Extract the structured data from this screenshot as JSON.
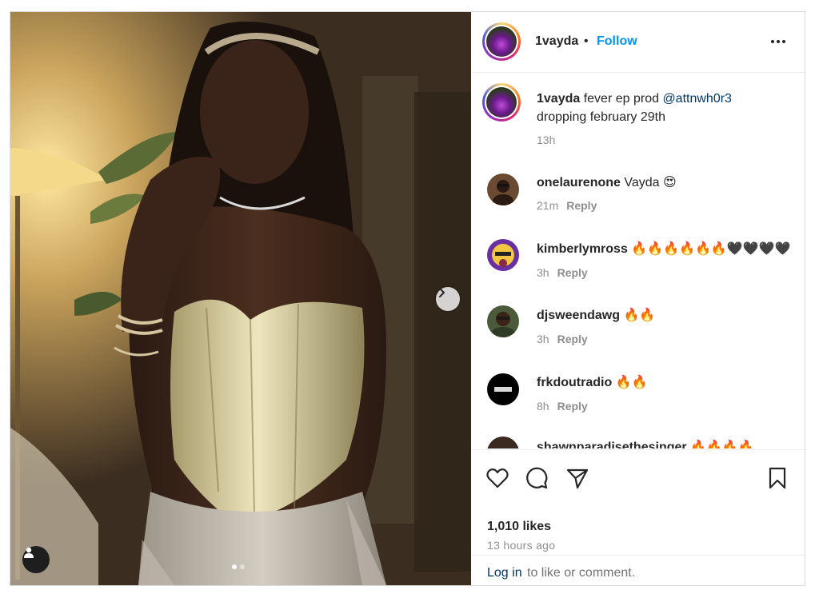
{
  "post": {
    "username": "1vayda",
    "separator": "•",
    "follow_label": "Follow",
    "more_icon": "more-horizontal-icon"
  },
  "caption": {
    "username": "1vayda",
    "text_before": " fever ep prod ",
    "mention": "@attnwh0r3",
    "text_line2": "dropping february 29th",
    "age": "13h"
  },
  "comments": [
    {
      "username": "onelaurenone",
      "text": " Vayda 😍",
      "age": "21m",
      "reply": "Reply",
      "avatar_color": "#7a5a3e"
    },
    {
      "username": "kimberlymross",
      "text": " 🔥🔥🔥🔥🔥🔥🖤🖤🖤🖤",
      "age": "3h",
      "reply": "Reply",
      "avatar_color": "#6a2fa0"
    },
    {
      "username": "djsweendawg",
      "text": " 🔥🔥",
      "age": "3h",
      "reply": "Reply",
      "avatar_color": "#4a5a3a"
    },
    {
      "username": "frkdoutradio",
      "text": " 🔥🔥",
      "age": "8h",
      "reply": "Reply",
      "avatar_color": "#000000"
    },
    {
      "username": "shawnparadisethesinger",
      "text": " 🔥🔥🔥🔥",
      "age": "",
      "reply": "",
      "avatar_color": "#3a2a20"
    }
  ],
  "actions": {
    "like_icon": "heart-icon",
    "comment_icon": "comment-icon",
    "share_icon": "send-icon",
    "save_icon": "bookmark-icon"
  },
  "likes": "1,010 likes",
  "posted": "13 hours ago",
  "login": {
    "link": "Log in",
    "rest": " to like or comment."
  },
  "carousel": {
    "slide_count": 2,
    "active_slide": 1
  },
  "colors": {
    "accent": "#0095f6",
    "mention": "#00376b",
    "muted": "#8e8e8e"
  }
}
